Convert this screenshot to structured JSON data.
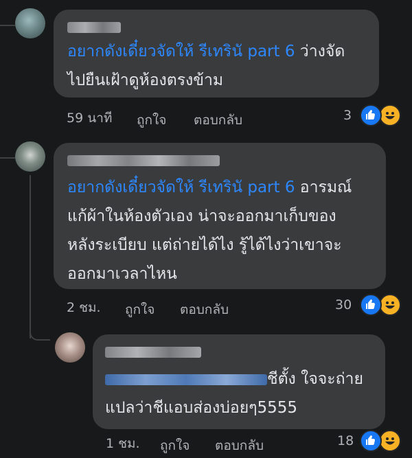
{
  "comments": [
    {
      "mention": "อยากดังเดี๋ยวจัดให้ รีเทรินั part 6",
      "line1_rest": " ว่างจัด",
      "line2": "ไปยืนเฝ้าดูห้องตรงข้าม",
      "time": "59 นาที",
      "like": "ถูกใจ",
      "reply": "ตอบกลับ",
      "reaction_count": "3",
      "reactions": [
        "like-icon",
        "haha-icon"
      ]
    },
    {
      "mention": "อยากดังเดี๋ยวจัดให้ รีเทรินั part 6",
      "line1_rest": " อารมณ์",
      "line2": "แก้ผ้าในห้องตัวเอง น่าจะออกมาเก็บของ",
      "line3": "หลังระเบียบ แต่ถ่ายได้ไง รู้ได้ไงว่าเขาจะ",
      "line4": "ออกมาเวลาไหน",
      "time": "2 ชม.",
      "like": "ถูกใจ",
      "reply": "ตอบกลับ",
      "reaction_count": "30",
      "reactions": [
        "like-icon",
        "haha-icon"
      ]
    },
    {
      "line1_rest": "ชีตั้ง ใจจะถ่าย",
      "line2": "แปลว่าชีแอบส่องบ่อยๆ5555",
      "time": "1 ชม.",
      "like": "ถูกใจ",
      "reply": "ตอบกลับ",
      "reaction_count": "18",
      "reactions": [
        "like-icon",
        "haha-icon"
      ]
    }
  ],
  "colors": {
    "background": "#18191a",
    "bubble": "#3a3b3c",
    "mention": "#2d88ff",
    "text": "#e4e6eb",
    "meta": "#b0b3b8"
  }
}
